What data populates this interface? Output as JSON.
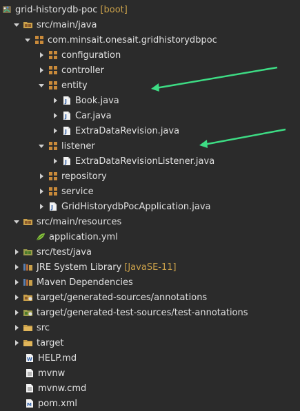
{
  "tree": [
    {
      "label": "grid-historydb-poc",
      "decoration": "[boot]",
      "icon": "project-icon",
      "arrow": "down"
    },
    {
      "label": "src/main/java",
      "icon": "source-folder-icon",
      "arrow": "down"
    },
    {
      "label": "com.minsait.onesait.gridhistorydbpoc",
      "icon": "package-icon",
      "arrow": "down"
    },
    {
      "label": "configuration",
      "icon": "package-icon",
      "arrow": "right"
    },
    {
      "label": "controller",
      "icon": "package-icon",
      "arrow": "right"
    },
    {
      "label": "entity",
      "icon": "package-icon",
      "arrow": "down"
    },
    {
      "label": "Book.java",
      "icon": "java-file-icon",
      "arrow": "right"
    },
    {
      "label": "Car.java",
      "icon": "java-file-icon",
      "arrow": "right"
    },
    {
      "label": "ExtraDataRevision.java",
      "icon": "java-file-icon",
      "arrow": "right"
    },
    {
      "label": "listener",
      "icon": "package-icon",
      "arrow": "down"
    },
    {
      "label": "ExtraDataRevisionListener.java",
      "icon": "java-file-icon",
      "arrow": "right"
    },
    {
      "label": "repository",
      "icon": "package-icon",
      "arrow": "right"
    },
    {
      "label": "service",
      "icon": "package-icon",
      "arrow": "right"
    },
    {
      "label": "GridHistorydbPocApplication.java",
      "icon": "java-file-icon",
      "arrow": "right"
    },
    {
      "label": "src/main/resources",
      "icon": "source-folder-icon",
      "arrow": "down"
    },
    {
      "label": "application.yml",
      "icon": "yaml-file-icon",
      "arrow": "none"
    },
    {
      "label": "src/test/java",
      "icon": "test-source-folder-icon",
      "arrow": "right"
    },
    {
      "label": "JRE System Library",
      "decoration": "[JavaSE-11]",
      "icon": "library-icon",
      "arrow": "right"
    },
    {
      "label": "Maven Dependencies",
      "icon": "library-icon",
      "arrow": "right"
    },
    {
      "label": "target/generated-sources/annotations",
      "icon": "generated-source-folder-icon",
      "arrow": "right"
    },
    {
      "label": "target/generated-test-sources/test-annotations",
      "icon": "generated-source-folder-icon",
      "arrow": "right"
    },
    {
      "label": "src",
      "icon": "folder-icon",
      "arrow": "right"
    },
    {
      "label": "target",
      "icon": "folder-icon",
      "arrow": "right"
    },
    {
      "label": "HELP.md",
      "icon": "markdown-file-icon",
      "arrow": "none"
    },
    {
      "label": "mvnw",
      "icon": "text-file-icon",
      "arrow": "none"
    },
    {
      "label": "mvnw.cmd",
      "icon": "text-file-icon",
      "arrow": "none"
    },
    {
      "label": "pom.xml",
      "icon": "maven-pom-icon",
      "arrow": "none"
    }
  ],
  "colors": {
    "background": "#2b2b2b",
    "text": "#e0e0e0",
    "decoration": "#c9a04a",
    "annotation_arrow": "#3ddc84"
  }
}
